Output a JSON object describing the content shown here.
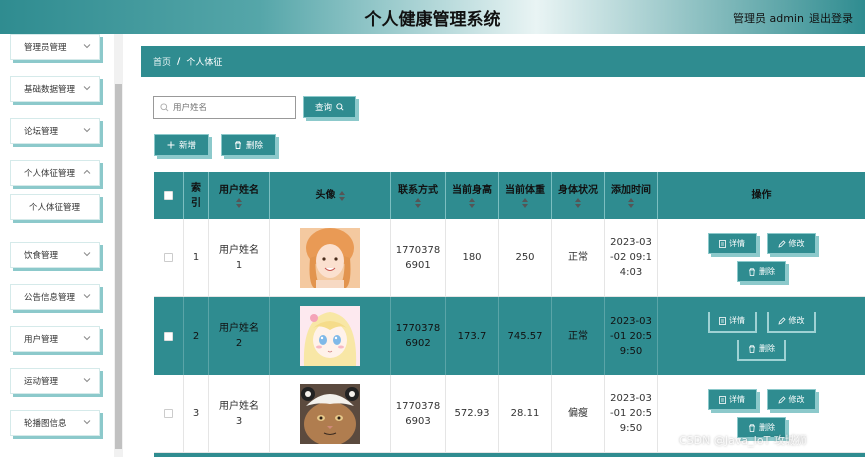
{
  "header": {
    "title": "个人健康管理系统",
    "user": "管理员 admin",
    "logout": "退出登录"
  },
  "sidebar": {
    "items": [
      {
        "label": "管理员管理"
      },
      {
        "label": "基础数据管理"
      },
      {
        "label": "论坛管理"
      },
      {
        "label": "个人体征管理"
      },
      {
        "label": "饮食管理"
      },
      {
        "label": "公告信息管理"
      },
      {
        "label": "用户管理"
      },
      {
        "label": "运动管理"
      },
      {
        "label": "轮播图信息"
      }
    ],
    "active_sub": "个人体征管理"
  },
  "breadcrumb": {
    "home": "首页",
    "sep": "/",
    "current": "个人体征"
  },
  "search": {
    "placeholder": "用户姓名",
    "query_label": "查询"
  },
  "actions": {
    "add_label": "新增",
    "delete_label": "删除"
  },
  "table": {
    "columns": [
      "索引",
      "用户姓名",
      "头像",
      "联系方式",
      "当前身高",
      "当前体重",
      "身体状况",
      "添加时间",
      "操作"
    ],
    "rows": [
      {
        "index": "1",
        "name": "用户姓名\n1",
        "phone": "1770378\n6901",
        "height": "180",
        "weight": "250",
        "status": "正常",
        "time": "2023-03\n-02 09:1\n4:03"
      },
      {
        "index": "2",
        "name": "用户姓名\n2",
        "phone": "1770378\n6902",
        "height": "173.7",
        "weight": "745.57",
        "status": "正常",
        "time": "2023-03\n-01 20:5\n9:50"
      },
      {
        "index": "3",
        "name": "用户姓名\n3",
        "phone": "1770378\n6903",
        "height": "572.93",
        "weight": "28.11",
        "status": "偏瘦",
        "time": "2023-03\n-01 20:5\n9:50"
      }
    ],
    "op_detail": "详情",
    "op_edit": "修改",
    "op_delete": "删除"
  },
  "watermark": "CSDN @Java_IoT 攻城狮",
  "colors": {
    "primary": "#2f8c90",
    "accent_shadow": "#8cc9cb"
  }
}
